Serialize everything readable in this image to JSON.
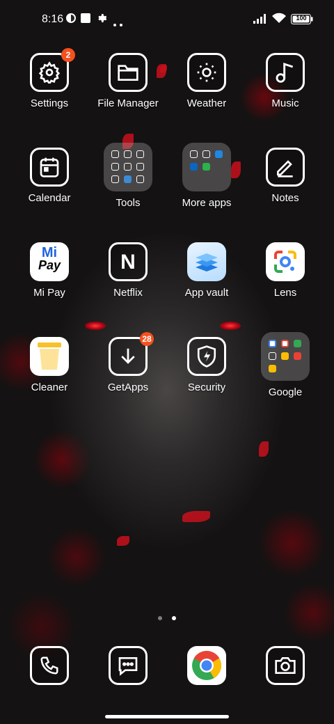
{
  "status_bar": {
    "time": "8:16",
    "battery": "100"
  },
  "apps": [
    {
      "label": "Settings",
      "icon": "gear-icon",
      "badge": "2"
    },
    {
      "label": "File Manager",
      "icon": "folder-icon"
    },
    {
      "label": "Weather",
      "icon": "sun-icon"
    },
    {
      "label": "Music",
      "icon": "music-note-icon"
    },
    {
      "label": "Calendar",
      "icon": "calendar-icon"
    },
    {
      "label": "Tools",
      "icon": "folder-grid-icon"
    },
    {
      "label": "More apps",
      "icon": "folder-grid-icon"
    },
    {
      "label": "Notes",
      "icon": "pencil-icon"
    },
    {
      "label": "Mi Pay",
      "icon": "mi-pay-logo",
      "logo_top": "Mi",
      "logo_bottom": "Pay"
    },
    {
      "label": "Netflix",
      "icon": "netflix-logo",
      "logo_text": "N"
    },
    {
      "label": "App vault",
      "icon": "stacked-layers-icon"
    },
    {
      "label": "Lens",
      "icon": "google-lens-icon"
    },
    {
      "label": "Cleaner",
      "icon": "trash-can-icon"
    },
    {
      "label": "GetApps",
      "icon": "download-arrow-icon",
      "badge": "28"
    },
    {
      "label": "Security",
      "icon": "shield-bolt-icon"
    },
    {
      "label": "Google",
      "icon": "folder-grid-icon"
    }
  ],
  "dock": [
    {
      "icon": "phone-icon"
    },
    {
      "icon": "message-icon"
    },
    {
      "icon": "chrome-icon"
    },
    {
      "icon": "camera-icon"
    }
  ],
  "pager": {
    "pages": 2,
    "active": 2
  },
  "colors": {
    "badge": "#f4511e",
    "accent_red": "#c8101c",
    "background": "#141212"
  }
}
